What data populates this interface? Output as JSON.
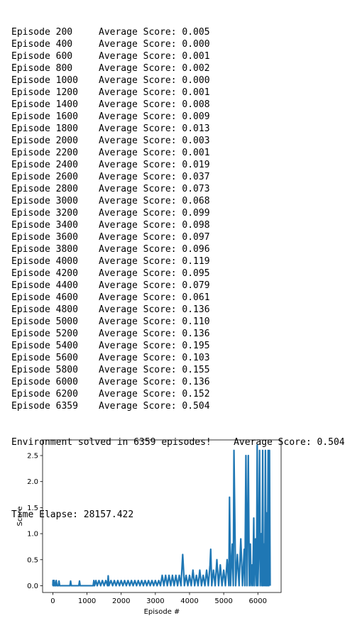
{
  "log": {
    "rows": [
      {
        "episode": "Episode 200",
        "score": "Average Score: 0.005"
      },
      {
        "episode": "Episode 400",
        "score": "Average Score: 0.000"
      },
      {
        "episode": "Episode 600",
        "score": "Average Score: 0.001"
      },
      {
        "episode": "Episode 800",
        "score": "Average Score: 0.002"
      },
      {
        "episode": "Episode 1000",
        "score": "Average Score: 0.000"
      },
      {
        "episode": "Episode 1200",
        "score": "Average Score: 0.001"
      },
      {
        "episode": "Episode 1400",
        "score": "Average Score: 0.008"
      },
      {
        "episode": "Episode 1600",
        "score": "Average Score: 0.009"
      },
      {
        "episode": "Episode 1800",
        "score": "Average Score: 0.013"
      },
      {
        "episode": "Episode 2000",
        "score": "Average Score: 0.003"
      },
      {
        "episode": "Episode 2200",
        "score": "Average Score: 0.001"
      },
      {
        "episode": "Episode 2400",
        "score": "Average Score: 0.019"
      },
      {
        "episode": "Episode 2600",
        "score": "Average Score: 0.037"
      },
      {
        "episode": "Episode 2800",
        "score": "Average Score: 0.073"
      },
      {
        "episode": "Episode 3000",
        "score": "Average Score: 0.068"
      },
      {
        "episode": "Episode 3200",
        "score": "Average Score: 0.099"
      },
      {
        "episode": "Episode 3400",
        "score": "Average Score: 0.098"
      },
      {
        "episode": "Episode 3600",
        "score": "Average Score: 0.097"
      },
      {
        "episode": "Episode 3800",
        "score": "Average Score: 0.096"
      },
      {
        "episode": "Episode 4000",
        "score": "Average Score: 0.119"
      },
      {
        "episode": "Episode 4200",
        "score": "Average Score: 0.095"
      },
      {
        "episode": "Episode 4400",
        "score": "Average Score: 0.079"
      },
      {
        "episode": "Episode 4600",
        "score": "Average Score: 0.061"
      },
      {
        "episode": "Episode 4800",
        "score": "Average Score: 0.136"
      },
      {
        "episode": "Episode 5000",
        "score": "Average Score: 0.110"
      },
      {
        "episode": "Episode 5200",
        "score": "Average Score: 0.136"
      },
      {
        "episode": "Episode 5400",
        "score": "Average Score: 0.195"
      },
      {
        "episode": "Episode 5600",
        "score": "Average Score: 0.103"
      },
      {
        "episode": "Episode 5800",
        "score": "Average Score: 0.155"
      },
      {
        "episode": "Episode 6000",
        "score": "Average Score: 0.136"
      },
      {
        "episode": "Episode 6200",
        "score": "Average Score: 0.152"
      },
      {
        "episode": "Episode 6359",
        "score": "Average Score: 0.504"
      }
    ],
    "solved_message": "Environment solved in 6359 episodes!\tAverage Score: 0.504",
    "time_elapsed": "Time Elapse: 28157.422"
  },
  "chart_data": {
    "type": "line",
    "xlabel": "Episode #",
    "ylabel": "Score",
    "xlim": [
      -300,
      6680
    ],
    "ylim": [
      -0.13,
      2.8
    ],
    "xticks": [
      0,
      1000,
      2000,
      3000,
      4000,
      5000,
      6000
    ],
    "yticks": [
      0.0,
      0.5,
      1.0,
      1.5,
      2.0,
      2.5
    ],
    "ytick_labels": [
      "0.0",
      "0.5",
      "1.0",
      "1.5",
      "2.0",
      "2.5"
    ],
    "line_color": "#1f77b4",
    "x": [
      0,
      5,
      10,
      20,
      30,
      40,
      60,
      80,
      100,
      120,
      140,
      160,
      180,
      200,
      220,
      260,
      300,
      350,
      400,
      450,
      500,
      520,
      540,
      600,
      700,
      760,
      780,
      800,
      900,
      1000,
      1100,
      1180,
      1200,
      1220,
      1260,
      1300,
      1350,
      1400,
      1450,
      1500,
      1550,
      1600,
      1620,
      1640,
      1700,
      1750,
      1800,
      1850,
      1900,
      1950,
      2000,
      2050,
      2100,
      2150,
      2200,
      2250,
      2300,
      2350,
      2400,
      2450,
      2500,
      2550,
      2600,
      2650,
      2700,
      2750,
      2800,
      2850,
      2900,
      2950,
      3000,
      3050,
      3100,
      3150,
      3200,
      3250,
      3300,
      3350,
      3400,
      3450,
      3500,
      3550,
      3600,
      3650,
      3700,
      3750,
      3800,
      3850,
      3900,
      3950,
      4000,
      4050,
      4100,
      4150,
      4200,
      4250,
      4300,
      4350,
      4400,
      4450,
      4500,
      4550,
      4600,
      4620,
      4650,
      4700,
      4750,
      4800,
      4850,
      4900,
      4950,
      5000,
      5050,
      5100,
      5150,
      5170,
      5200,
      5250,
      5280,
      5300,
      5350,
      5400,
      5450,
      5500,
      5550,
      5600,
      5620,
      5650,
      5680,
      5700,
      5720,
      5750,
      5780,
      5800,
      5830,
      5850,
      5880,
      5900,
      5930,
      5960,
      5980,
      6000,
      6020,
      6050,
      6070,
      6100,
      6120,
      6140,
      6160,
      6180,
      6200,
      6220,
      6240,
      6260,
      6280,
      6300,
      6320,
      6340,
      6359
    ],
    "y": [
      0.0,
      0.1,
      0.0,
      0.1,
      0.0,
      0.1,
      0.0,
      0.0,
      0.1,
      0.0,
      0.0,
      0.0,
      0.09,
      0.0,
      0.0,
      0.0,
      0.0,
      0.0,
      0.0,
      0.0,
      0.0,
      0.09,
      0.0,
      0.0,
      0.0,
      0.0,
      0.09,
      0.0,
      0.0,
      0.0,
      0.0,
      0.0,
      0.1,
      0.0,
      0.1,
      0.0,
      0.1,
      0.0,
      0.1,
      0.0,
      0.1,
      0.0,
      0.19,
      0.0,
      0.1,
      0.0,
      0.1,
      0.0,
      0.1,
      0.0,
      0.1,
      0.0,
      0.1,
      0.0,
      0.1,
      0.0,
      0.1,
      0.0,
      0.1,
      0.0,
      0.1,
      0.0,
      0.1,
      0.0,
      0.1,
      0.0,
      0.1,
      0.0,
      0.1,
      0.0,
      0.1,
      0.0,
      0.1,
      0.0,
      0.2,
      0.0,
      0.2,
      0.0,
      0.2,
      0.0,
      0.2,
      0.0,
      0.2,
      0.0,
      0.2,
      0.0,
      0.6,
      0.0,
      0.2,
      0.0,
      0.2,
      0.0,
      0.3,
      0.0,
      0.2,
      0.0,
      0.3,
      0.0,
      0.2,
      0.0,
      0.3,
      0.0,
      0.4,
      0.7,
      0.0,
      0.3,
      0.0,
      0.5,
      0.0,
      0.4,
      0.0,
      0.3,
      0.0,
      0.5,
      0.0,
      1.7,
      0.0,
      0.8,
      0.0,
      2.6,
      0.0,
      0.6,
      0.0,
      0.9,
      0.0,
      0.7,
      0.0,
      2.5,
      0.0,
      1.1,
      2.5,
      0.0,
      0.8,
      0.0,
      0.4,
      0.0,
      1.3,
      0.0,
      0.9,
      0.0,
      2.7,
      0.0,
      0.5,
      2.6,
      0.0,
      1.0,
      0.0,
      2.6,
      0.0,
      0.8,
      0.0,
      2.6,
      0.0,
      1.4,
      0.0,
      2.6,
      0.0,
      2.6,
      0.0,
      0.9,
      2.6
    ]
  }
}
